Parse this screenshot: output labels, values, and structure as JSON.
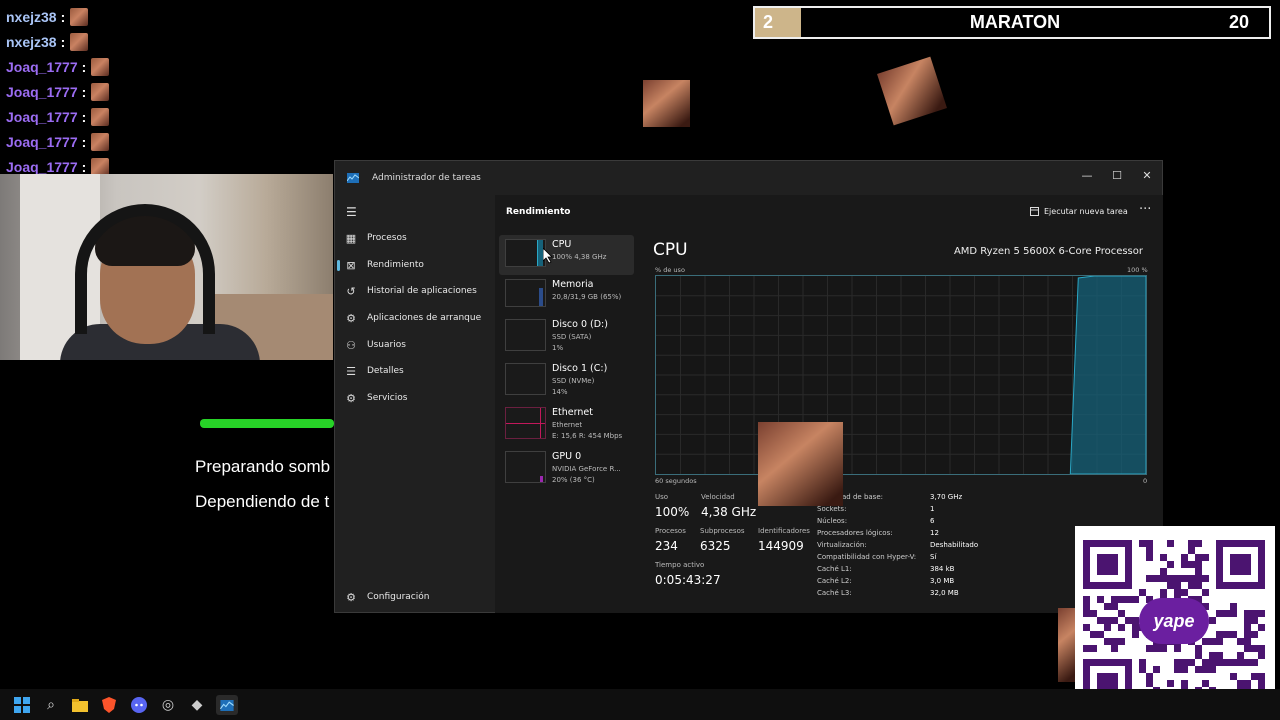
{
  "chat": {
    "messages": [
      {
        "user": "nxejz38",
        "sep": ":",
        "color": "#a9c4f5"
      },
      {
        "user": "nxejz38",
        "sep": ":",
        "color": "#a9c4f5"
      },
      {
        "user": "Joaq_1777",
        "sep": ":",
        "color": "#9b6cf2"
      },
      {
        "user": "Joaq_1777",
        "sep": ":",
        "color": "#9b6cf2"
      },
      {
        "user": "Joaq_1777",
        "sep": ":",
        "color": "#9b6cf2"
      },
      {
        "user": "Joaq_1777",
        "sep": ":",
        "color": "#9b6cf2"
      },
      {
        "user": "Joaq_1777",
        "sep": ":",
        "color": "#9b6cf2"
      }
    ]
  },
  "maraton": {
    "left_number": "2",
    "title": "MARATON",
    "right_number": "20"
  },
  "loading": {
    "line1": "Preparando somb",
    "line2": "Dependiendo de t",
    "progress": 1.0
  },
  "taskmgr": {
    "app_title": "Administrador de tareas",
    "window_controls": {
      "minimize": "—",
      "maximize": "☐",
      "close": "✕"
    },
    "nav": [
      {
        "label": "Procesos",
        "icon": "grid-icon"
      },
      {
        "label": "Rendimiento",
        "icon": "performance-icon",
        "active": true
      },
      {
        "label": "Historial de aplicaciones",
        "icon": "history-icon"
      },
      {
        "label": "Aplicaciones de arranque",
        "icon": "startup-icon"
      },
      {
        "label": "Usuarios",
        "icon": "users-icon"
      },
      {
        "label": "Detalles",
        "icon": "details-icon"
      },
      {
        "label": "Servicios",
        "icon": "services-icon"
      }
    ],
    "settings_label": "Configuración",
    "header_title": "Rendimiento",
    "run_task_label": "Ejecutar nueva tarea",
    "more_label": "···",
    "perf_items": [
      {
        "name": "CPU",
        "sub1": "100% 4,38 GHz",
        "sub2": "",
        "color": "#2aa7c5"
      },
      {
        "name": "Memoria",
        "sub1": "20,8/31,9 GB (65%)",
        "sub2": "",
        "color": "#3a7bd5"
      },
      {
        "name": "Disco 0 (D:)",
        "sub1": "SSD (SATA)",
        "sub2": "1%",
        "color": "#6aa84f"
      },
      {
        "name": "Disco 1 (C:)",
        "sub1": "SSD (NVMe)",
        "sub2": "14%",
        "color": "#6aa84f"
      },
      {
        "name": "Ethernet",
        "sub1": "Ethernet",
        "sub2": "E: 15,6 R: 454 Mbps",
        "color": "#c2185b"
      },
      {
        "name": "GPU 0",
        "sub1": "NVIDIA GeForce R...",
        "sub2": "20% (36 °C)",
        "color": "#9c27b0"
      }
    ],
    "cpu": {
      "title": "CPU",
      "model": "AMD Ryzen 5 5600X 6-Core Processor",
      "usage_axis_label": "% de uso",
      "usage_axis_max": "100 %",
      "time_axis_label": "60 segundos",
      "time_axis_min": "0",
      "graph_color": "#16627a",
      "stats": {
        "uso_label": "Uso",
        "uso_value": "100%",
        "velocidad_label": "Velocidad",
        "velocidad_value": "4,38 GHz",
        "procesos_label": "Procesos",
        "procesos_value": "234",
        "subprocesos_label": "Subprocesos",
        "subprocesos_value": "6325",
        "identificadores_label": "Identificadores",
        "identificadores_value": "144909",
        "tiempo_label": "Tiempo activo",
        "tiempo_value": "0:05:43:27"
      },
      "specs": [
        {
          "k": "Velocidad de base:",
          "v": "3,70 GHz"
        },
        {
          "k": "Sockets:",
          "v": "1"
        },
        {
          "k": "Núcleos:",
          "v": "6"
        },
        {
          "k": "Procesadores lógicos:",
          "v": "12"
        },
        {
          "k": "Virtualización:",
          "v": "Deshabilitado"
        },
        {
          "k": "Compatibilidad con Hyper-V:",
          "v": "Sí"
        },
        {
          "k": "Caché L1:",
          "v": "384 kB"
        },
        {
          "k": "Caché L2:",
          "v": "3,0 MB"
        },
        {
          "k": "Caché L3:",
          "v": "32,0 MB"
        }
      ]
    }
  },
  "qr": {
    "brand": "yape",
    "brand_color": "#6b1fa0"
  }
}
